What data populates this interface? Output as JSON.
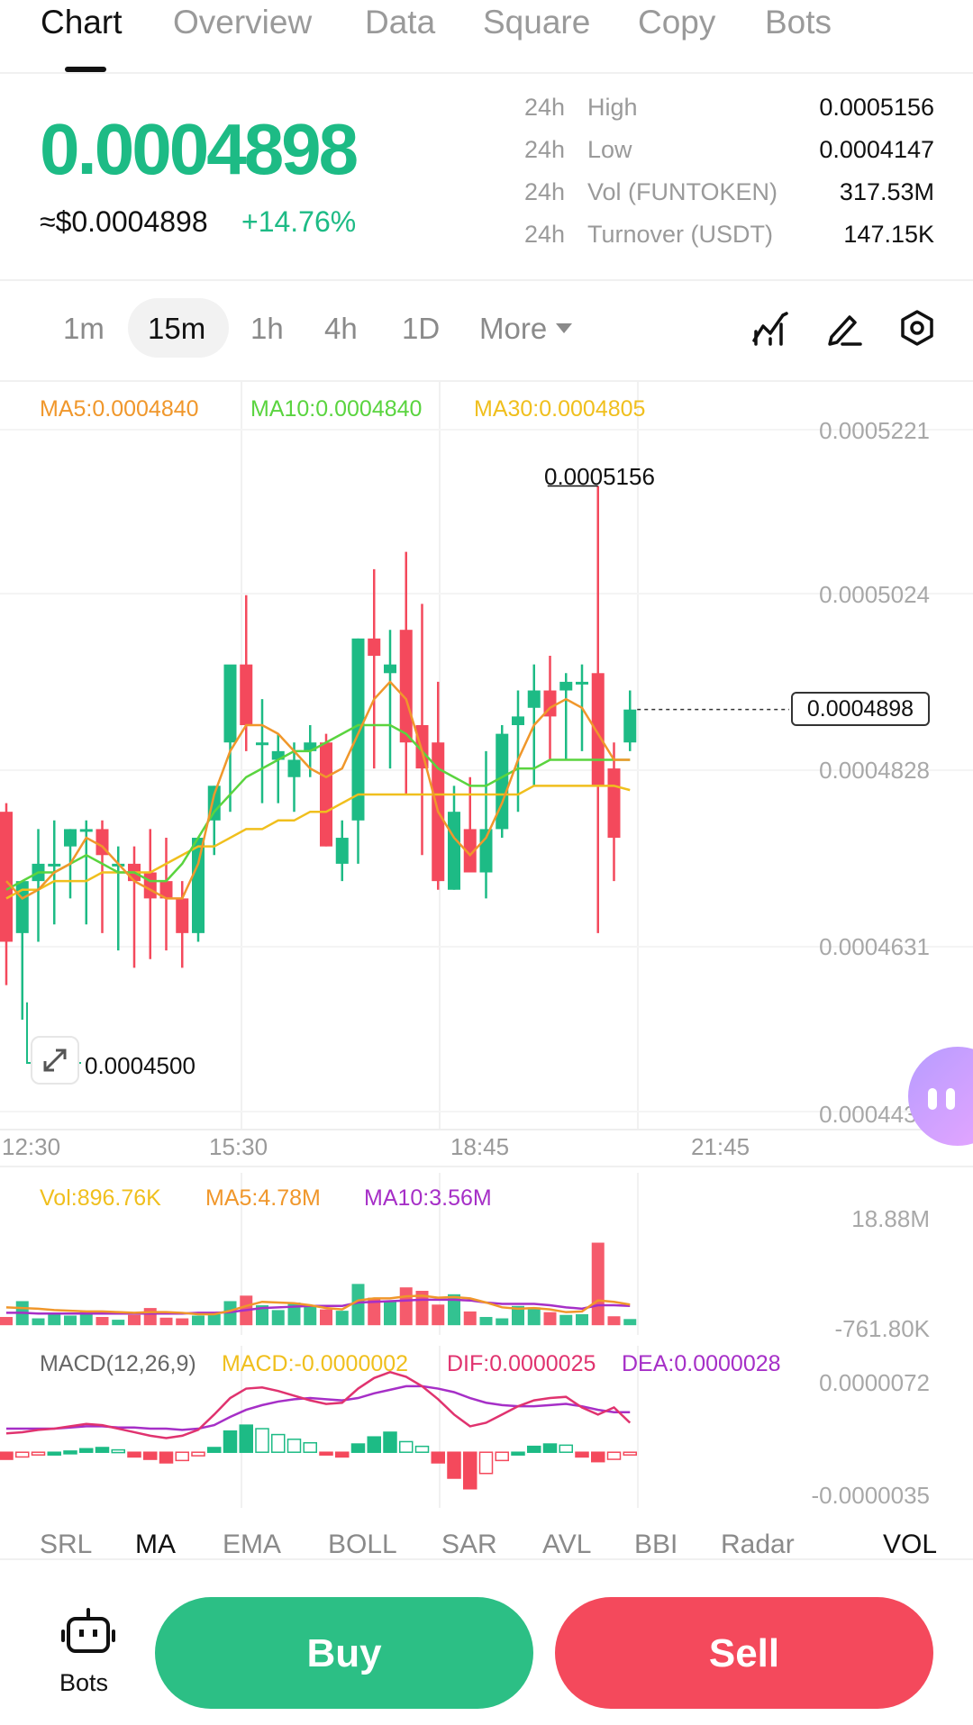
{
  "tabs": [
    {
      "label": "Chart",
      "active": true
    },
    {
      "label": "Overview"
    },
    {
      "label": "Data"
    },
    {
      "label": "Square"
    },
    {
      "label": "Copy"
    },
    {
      "label": "Bots"
    }
  ],
  "price": {
    "last": "0.0004898",
    "usd": "≈$0.0004898",
    "change": "+14.76%",
    "color_up": "#1dbb85",
    "color_down": "#f4495c"
  },
  "stats": [
    {
      "period": "24h",
      "label": "High",
      "value": "0.0005156"
    },
    {
      "period": "24h",
      "label": "Low",
      "value": "0.0004147"
    },
    {
      "period": "24h",
      "label": "Vol (FUNTOKEN)",
      "value": "317.53M"
    },
    {
      "period": "24h",
      "label": "Turnover (USDT)",
      "value": "147.15K"
    }
  ],
  "intervals": [
    {
      "label": "1m"
    },
    {
      "label": "15m",
      "active": true
    },
    {
      "label": "1h"
    },
    {
      "label": "4h"
    },
    {
      "label": "1D"
    },
    {
      "label": "More"
    }
  ],
  "tools": [
    "indicator-icon",
    "draw-pen-icon",
    "settings-hexagon-icon"
  ],
  "ma_legend": {
    "ma5": {
      "text": "MA5:0.0004840",
      "color": "#f0972b"
    },
    "ma10": {
      "text": "MA10:0.0004840",
      "color": "#5ad43f"
    },
    "ma30": {
      "text": "MA30:0.0004805",
      "color": "#f0bf1d"
    }
  },
  "price_axis": [
    "0.0005221",
    "0.0005024",
    "0.0004828",
    "0.0004631",
    "0.0004434"
  ],
  "time_axis": [
    "12:30",
    "15:30",
    "18:45",
    "21:45"
  ],
  "high_marker": "0.0005156",
  "low_marker": "0.0004500",
  "last_price_marker": "0.0004898",
  "volume_legend": {
    "vol": {
      "text": "Vol:896.76K",
      "color": "#f0bf1d"
    },
    "ma5": {
      "text": "MA5:4.78M",
      "color": "#f0972b"
    },
    "ma10": {
      "text": "MA10:3.56M",
      "color": "#a62fc7"
    }
  },
  "volume_axis": [
    "18.88M",
    "-761.80K"
  ],
  "macd_legend": {
    "name": {
      "text": "MACD(12,26,9)",
      "color": "#666666"
    },
    "macd": {
      "text": "MACD:-0.0000002",
      "color": "#f0bf1d"
    },
    "dif": {
      "text": "DIF:0.0000025",
      "color": "#e0336f"
    },
    "dea": {
      "text": "DEA:0.0000028",
      "color": "#a62fc7"
    }
  },
  "macd_axis": [
    "0.0000072",
    "-0.0000035"
  ],
  "indicator_tabs": [
    {
      "label": "SRL"
    },
    {
      "label": "MA",
      "active": true
    },
    {
      "label": "EMA"
    },
    {
      "label": "BOLL"
    },
    {
      "label": "SAR"
    },
    {
      "label": "AVL"
    },
    {
      "label": "BBI"
    },
    {
      "label": "Radar"
    },
    {
      "label": "VOL",
      "active": true
    }
  ],
  "bottom": {
    "bots_label": "Bots",
    "buy_label": "Buy",
    "sell_label": "Sell"
  },
  "chart_data": {
    "type": "candlestick",
    "ylim": [
      0.0004434,
      0.0005221
    ],
    "candles": [
      {
        "o": 0.000478,
        "h": 0.000479,
        "l": 0.000458,
        "c": 0.000463
      },
      {
        "o": 0.000464,
        "h": 0.000468,
        "l": 0.000454,
        "c": 0.00047
      },
      {
        "o": 0.00047,
        "h": 0.000476,
        "l": 0.000463,
        "c": 0.000472
      },
      {
        "o": 0.000472,
        "h": 0.000477,
        "l": 0.000465,
        "c": 0.000472
      },
      {
        "o": 0.000474,
        "h": 0.000476,
        "l": 0.000468,
        "c": 0.000476
      },
      {
        "o": 0.000476,
        "h": 0.000477,
        "l": 0.000465,
        "c": 0.000476
      },
      {
        "o": 0.000476,
        "h": 0.000477,
        "l": 0.000464,
        "c": 0.000473
      },
      {
        "o": 0.000472,
        "h": 0.000474,
        "l": 0.000462,
        "c": 0.000472
      },
      {
        "o": 0.000472,
        "h": 0.000474,
        "l": 0.00046,
        "c": 0.00047
      },
      {
        "o": 0.000471,
        "h": 0.000476,
        "l": 0.000461,
        "c": 0.000468
      },
      {
        "o": 0.00047,
        "h": 0.000475,
        "l": 0.000462,
        "c": 0.000468
      },
      {
        "o": 0.000468,
        "h": 0.00047,
        "l": 0.00046,
        "c": 0.000464
      },
      {
        "o": 0.000464,
        "h": 0.000471,
        "l": 0.000463,
        "c": 0.000475
      },
      {
        "o": 0.000477,
        "h": 0.000481,
        "l": 0.000473,
        "c": 0.000481
      },
      {
        "o": 0.000486,
        "h": 0.00049,
        "l": 0.000478,
        "c": 0.000495
      },
      {
        "o": 0.000495,
        "h": 0.000503,
        "l": 0.000485,
        "c": 0.000488
      },
      {
        "o": 0.000486,
        "h": 0.000491,
        "l": 0.000479,
        "c": 0.000486
      },
      {
        "o": 0.000484,
        "h": 0.000487,
        "l": 0.000479,
        "c": 0.000485
      },
      {
        "o": 0.000482,
        "h": 0.000486,
        "l": 0.000478,
        "c": 0.000484
      },
      {
        "o": 0.000485,
        "h": 0.000488,
        "l": 0.000482,
        "c": 0.000486
      },
      {
        "o": 0.000486,
        "h": 0.000487,
        "l": 0.000474,
        "c": 0.000474
      },
      {
        "o": 0.000472,
        "h": 0.000477,
        "l": 0.00047,
        "c": 0.000475
      },
      {
        "o": 0.000477,
        "h": 0.000498,
        "l": 0.000472,
        "c": 0.000498
      },
      {
        "o": 0.000498,
        "h": 0.000506,
        "l": 0.000483,
        "c": 0.000496
      },
      {
        "o": 0.000494,
        "h": 0.000499,
        "l": 0.000483,
        "c": 0.000495
      },
      {
        "o": 0.000499,
        "h": 0.000508,
        "l": 0.00048,
        "c": 0.000486
      },
      {
        "o": 0.000488,
        "h": 0.000502,
        "l": 0.000473,
        "c": 0.000483
      },
      {
        "o": 0.000486,
        "h": 0.000493,
        "l": 0.000469,
        "c": 0.00047
      },
      {
        "o": 0.000469,
        "h": 0.000481,
        "l": 0.000469,
        "c": 0.000478
      },
      {
        "o": 0.000476,
        "h": 0.000482,
        "l": 0.000471,
        "c": 0.000471
      },
      {
        "o": 0.000471,
        "h": 0.000485,
        "l": 0.000468,
        "c": 0.000476
      },
      {
        "o": 0.000476,
        "h": 0.000488,
        "l": 0.000475,
        "c": 0.000487
      },
      {
        "o": 0.000488,
        "h": 0.000492,
        "l": 0.000478,
        "c": 0.000489
      },
      {
        "o": 0.00049,
        "h": 0.000495,
        "l": 0.000481,
        "c": 0.000492
      },
      {
        "o": 0.000492,
        "h": 0.000496,
        "l": 0.000484,
        "c": 0.000489
      },
      {
        "o": 0.000492,
        "h": 0.000494,
        "l": 0.000484,
        "c": 0.000493
      },
      {
        "o": 0.000493,
        "h": 0.000495,
        "l": 0.000485,
        "c": 0.000493
      },
      {
        "o": 0.000494,
        "h": 0.0005156,
        "l": 0.000464,
        "c": 0.000481
      },
      {
        "o": 0.000483,
        "h": 0.000486,
        "l": 0.00047,
        "c": 0.000475
      },
      {
        "o": 0.000486,
        "h": 0.000492,
        "l": 0.000485,
        "c": 0.0004898
      }
    ],
    "ma5": [
      0.00047,
      0.000468,
      0.000469,
      0.000471,
      0.000472,
      0.000475,
      0.000474,
      0.000472,
      0.00047,
      0.000469,
      0.000468,
      0.000468,
      0.000472,
      0.00048,
      0.000485,
      0.000488,
      0.000488,
      0.000487,
      0.000485,
      0.000483,
      0.000482,
      0.000483,
      0.000487,
      0.000491,
      0.000493,
      0.000491,
      0.000485,
      0.000478,
      0.000475,
      0.000473,
      0.000475,
      0.000479,
      0.000484,
      0.000488,
      0.00049,
      0.000491,
      0.00049,
      0.000487,
      0.000484,
      0.000484
    ],
    "ma10": [
      0.000469,
      0.00047,
      0.000471,
      0.000471,
      0.000472,
      0.000473,
      0.000472,
      0.000471,
      0.000471,
      0.00047,
      0.00047,
      0.000472,
      0.000475,
      0.000478,
      0.00048,
      0.000482,
      0.000483,
      0.000484,
      0.000485,
      0.000485,
      0.000486,
      0.000487,
      0.000488,
      0.000488,
      0.000488,
      0.000487,
      0.000485,
      0.000483,
      0.000482,
      0.000481,
      0.000481,
      0.000482,
      0.000483,
      0.000483,
      0.000484,
      0.000484,
      0.000484,
      0.000484,
      0.000484,
      0.000484
    ],
    "ma30": [
      0.000468,
      0.000469,
      0.000469,
      0.00047,
      0.00047,
      0.00047,
      0.000471,
      0.000471,
      0.000471,
      0.000471,
      0.000472,
      0.000473,
      0.000474,
      0.000474,
      0.000475,
      0.000476,
      0.000476,
      0.000477,
      0.000477,
      0.000478,
      0.000478,
      0.000479,
      0.00048,
      0.00048,
      0.00048,
      0.00048,
      0.00048,
      0.00048,
      0.00048,
      0.00048,
      0.00048,
      0.00048,
      0.00048,
      0.000481,
      0.000481,
      0.000481,
      0.000481,
      0.000481,
      0.000481,
      0.0004805
    ],
    "volume": [
      1.2,
      3.5,
      1.0,
      1.8,
      1.4,
      2.0,
      1.2,
      0.8,
      1.5,
      2.5,
      1.1,
      1.0,
      1.4,
      1.6,
      3.5,
      4.3,
      2.9,
      2.2,
      3.3,
      2.8,
      2.3,
      2.1,
      6.0,
      4.0,
      3.5,
      5.5,
      5.0,
      3.0,
      4.5,
      2.0,
      1.2,
      1.0,
      2.8,
      2.6,
      1.9,
      1.5,
      1.6,
      12.0,
      1.3,
      0.9
    ],
    "volume_ylim": [
      -0.7618,
      18.88
    ],
    "vol_ma5": [
      2.6,
      2.5,
      2.4,
      2.2,
      2.1,
      2.0,
      2.0,
      1.9,
      1.8,
      1.9,
      1.9,
      1.8,
      1.6,
      1.6,
      2.1,
      2.8,
      3.4,
      3.3,
      3.2,
      2.9,
      2.5,
      2.3,
      3.6,
      3.9,
      3.9,
      4.2,
      4.3,
      4.0,
      4.1,
      3.9,
      3.3,
      2.6,
      2.4,
      2.5,
      2.3,
      1.9,
      2.0,
      3.6,
      3.4,
      3.0
    ],
    "vol_ma10": [
      1.8,
      1.8,
      1.7,
      1.7,
      1.7,
      1.7,
      1.7,
      1.7,
      1.7,
      1.7,
      1.7,
      1.7,
      1.8,
      1.8,
      1.9,
      2.2,
      2.5,
      2.6,
      2.7,
      2.8,
      2.8,
      2.8,
      3.3,
      3.4,
      3.5,
      3.6,
      3.7,
      3.7,
      3.7,
      3.6,
      3.3,
      3.1,
      3.1,
      3.1,
      2.9,
      2.6,
      2.4,
      2.9,
      2.9,
      2.8
    ],
    "macd_hist": [
      -0.6,
      -0.4,
      -0.2,
      0.0,
      0.1,
      0.3,
      0.4,
      0.2,
      -0.4,
      -0.6,
      -0.9,
      -0.7,
      -0.3,
      0.4,
      1.8,
      2.3,
      2.0,
      1.5,
      1.1,
      0.8,
      -0.1,
      -0.4,
      0.7,
      1.3,
      1.7,
      0.9,
      0.5,
      -0.9,
      -2.2,
      -3.1,
      -1.8,
      -0.7,
      0.0,
      0.5,
      0.7,
      0.6,
      -0.4,
      -0.8,
      -0.6,
      -0.2
    ],
    "dif": [
      1.6,
      1.7,
      1.9,
      2.0,
      2.2,
      2.4,
      2.3,
      2.0,
      1.7,
      1.4,
      1.2,
      1.4,
      1.9,
      3.2,
      4.6,
      5.4,
      5.5,
      5.2,
      4.8,
      4.4,
      4.1,
      4.2,
      5.4,
      6.3,
      6.8,
      6.4,
      5.6,
      4.5,
      3.2,
      2.2,
      2.5,
      3.2,
      3.9,
      4.4,
      4.6,
      4.7,
      3.8,
      3.2,
      3.8,
      2.5
    ],
    "dea": [
      2.0,
      2.0,
      2.0,
      2.0,
      2.1,
      2.2,
      2.2,
      2.1,
      2.1,
      2.0,
      2.0,
      1.9,
      2.0,
      2.3,
      3.0,
      3.6,
      4.0,
      4.3,
      4.5,
      4.6,
      4.5,
      4.4,
      4.6,
      5.0,
      5.3,
      5.6,
      5.6,
      5.4,
      5.1,
      4.6,
      4.2,
      4.0,
      3.9,
      3.9,
      4.0,
      4.1,
      3.9,
      3.6,
      3.4,
      3.4
    ],
    "macd_ylim": [
      -3.5,
      7.2
    ]
  }
}
